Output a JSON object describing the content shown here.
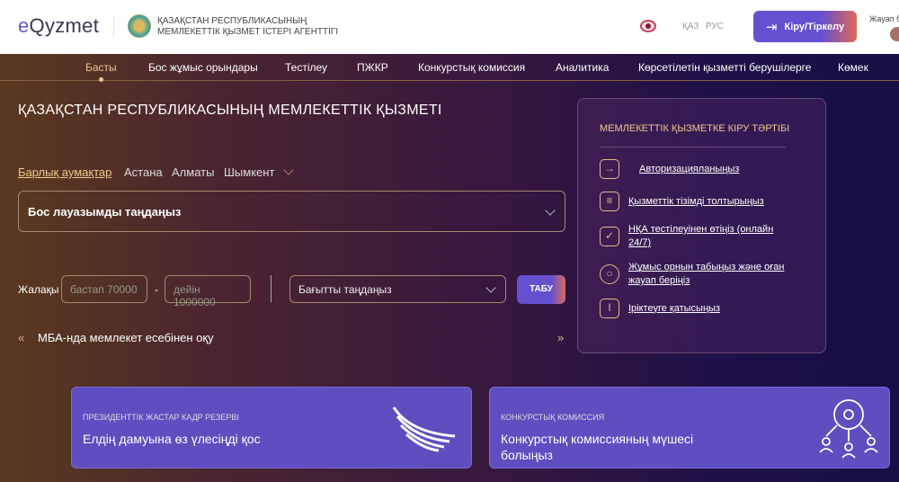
{
  "header": {
    "logo_prefix": "e",
    "logo_main": "Qyzmet",
    "agency_line1": "ҚАЗАҚСТАН РЕСПУБЛИКАСЫНЫҢ",
    "agency_line2": "МЕМЛЕКЕТТІК ҚЫЗМЕТ ІСТЕРІ АГЕНТТІГІ",
    "lang_kz": "ҚАЗ",
    "lang_ru": "РУС",
    "login_label": "Кіру/Тіркелу",
    "reply_label": "Жауап б"
  },
  "nav": [
    "Басты",
    "Бос жұмыс орындары",
    "Тестілеу",
    "ПЖКР",
    "Конкурстық комиссия",
    "Аналитика",
    "Көрсетілетін қызметті берушілерге",
    "Көмек"
  ],
  "main": {
    "title": "ҚАЗАҚСТАН РЕСПУБЛИКАСЫНЫҢ МЕМЛЕКЕТТІК ҚЫЗМЕТІ",
    "regions": [
      "Барлық аумақтар",
      "Астана",
      "Алматы",
      "Шымкент"
    ],
    "position_select": "Бос лауазымды таңдаңыз",
    "salary_label": "Жалақы",
    "salary_from_placeholder": "бастап 70000",
    "dash": "-",
    "salary_to_placeholder": "дейін 1000000",
    "direction_select": "Бағытты таңдаңыз",
    "find_label": "ТАБУ",
    "ticker": "МБА-нда мемлекет есебінен оқу"
  },
  "panel": {
    "title": "МЕМЛЕКЕТТІК ҚЫЗМЕТКЕ КІРУ ТӘРТІБІ",
    "steps": [
      {
        "label": "Авторизацияланыңыз",
        "icon": "login-icon"
      },
      {
        "label": "Қызметтік тізімді толтырыңыз",
        "icon": "form-edit-icon"
      },
      {
        "label": "НҚА тестілеуінен өтіңіз (онлайн 24/7)",
        "icon": "test-check-icon"
      },
      {
        "label": "Жұмыс орнын табыңыз және оған жауап беріңіз",
        "icon": "chat-search-icon"
      },
      {
        "label": "Іріктеуге қатысыңыз",
        "icon": "trophy-icon"
      }
    ]
  },
  "cards": [
    {
      "kicker": "ПРЕЗИДЕНТТІК ЖАСТАР КАДР РЕЗЕРВІ",
      "heading": "Елдің дамуына өз үлесіңді қос"
    },
    {
      "kicker": "КОНКУРСТЫҚ КОМИССИЯ",
      "heading": "Конкурстық комиссияның мүшесі болыңыз"
    }
  ]
}
